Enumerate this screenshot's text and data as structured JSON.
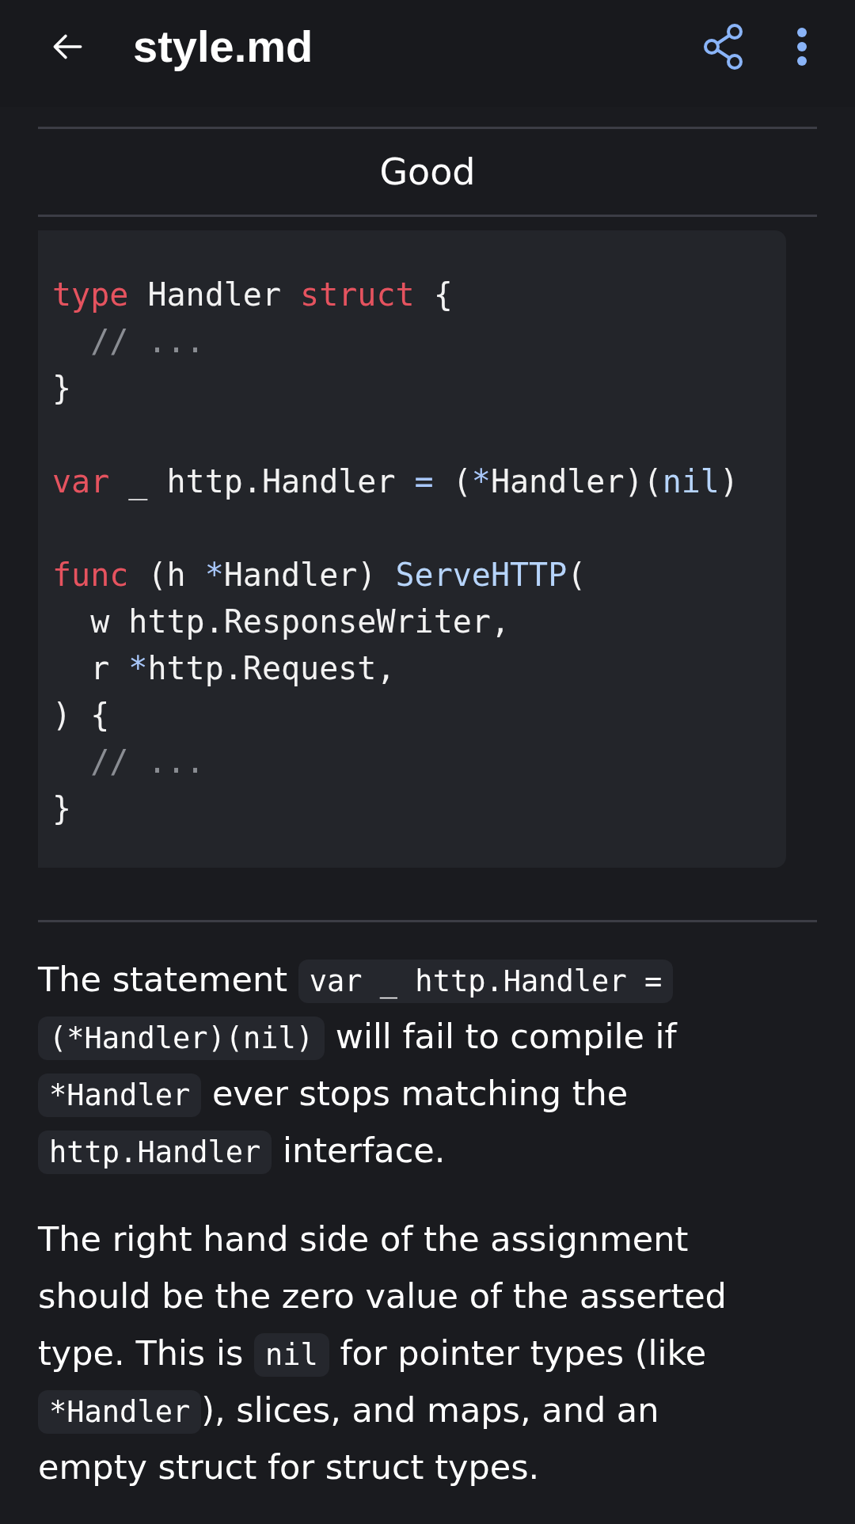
{
  "app_bar": {
    "title": "style.md"
  },
  "table_header": "Good",
  "code_block": {
    "lines": [
      {
        "kind": "code",
        "tokens": [
          {
            "text": "type",
            "kind": "keyword"
          },
          {
            "text": " Handler ",
            "kind": "plain"
          },
          {
            "text": "struct",
            "kind": "keyword"
          },
          {
            "text": " {",
            "kind": "plain"
          }
        ]
      },
      {
        "kind": "code",
        "tokens": [
          {
            "text": "  // ...",
            "kind": "comment"
          }
        ]
      },
      {
        "kind": "code",
        "tokens": [
          {
            "text": "}",
            "kind": "plain"
          }
        ]
      },
      {
        "kind": "blank"
      },
      {
        "kind": "code",
        "tokens": [
          {
            "text": "var",
            "kind": "keyword"
          },
          {
            "text": " _ http.Handler ",
            "kind": "plain"
          },
          {
            "text": "=",
            "kind": "operator"
          },
          {
            "text": " (",
            "kind": "plain"
          },
          {
            "text": "*",
            "kind": "operator"
          },
          {
            "text": "Handler)(",
            "kind": "plain"
          },
          {
            "text": "nil",
            "kind": "literal"
          },
          {
            "text": ")",
            "kind": "plain"
          }
        ]
      },
      {
        "kind": "blank"
      },
      {
        "kind": "code",
        "tokens": [
          {
            "text": "func",
            "kind": "keyword"
          },
          {
            "text": " (h ",
            "kind": "plain"
          },
          {
            "text": "*",
            "kind": "operator"
          },
          {
            "text": "Handler) ",
            "kind": "plain"
          },
          {
            "text": "ServeHTTP",
            "kind": "function"
          },
          {
            "text": "(",
            "kind": "plain"
          }
        ]
      },
      {
        "kind": "code",
        "tokens": [
          {
            "text": "  w http.ResponseWriter,",
            "kind": "plain"
          }
        ]
      },
      {
        "kind": "code",
        "tokens": [
          {
            "text": "  r ",
            "kind": "plain"
          },
          {
            "text": "*",
            "kind": "operator"
          },
          {
            "text": "http.Request,",
            "kind": "plain"
          }
        ]
      },
      {
        "kind": "code",
        "tokens": [
          {
            "text": ") {",
            "kind": "plain"
          }
        ]
      },
      {
        "kind": "code",
        "tokens": [
          {
            "text": "  // ...",
            "kind": "comment"
          }
        ]
      },
      {
        "kind": "code",
        "tokens": [
          {
            "text": "}",
            "kind": "plain"
          }
        ]
      }
    ]
  },
  "paragraphs": [
    {
      "lines": [
        [
          {
            "text": "The statement ",
            "kind": "text"
          },
          {
            "text": "var _ http.Handler =",
            "kind": "code"
          }
        ],
        [
          {
            "text": "(*Handler)(nil)",
            "kind": "code"
          },
          {
            "text": " will fail to compile if",
            "kind": "text"
          }
        ],
        [
          {
            "text": "*Handler",
            "kind": "code"
          },
          {
            "text": " ever stops matching the",
            "kind": "text"
          }
        ],
        [
          {
            "text": "http.Handler",
            "kind": "code"
          },
          {
            "text": " interface.",
            "kind": "text"
          }
        ]
      ]
    },
    {
      "lines": [
        [
          {
            "text": "The right hand side of the assignment",
            "kind": "text"
          }
        ],
        [
          {
            "text": "should be the zero value of the asserted",
            "kind": "text"
          }
        ],
        [
          {
            "text": "type. This is ",
            "kind": "text"
          },
          {
            "text": "nil",
            "kind": "code"
          },
          {
            "text": " for pointer types (like",
            "kind": "text"
          }
        ],
        [
          {
            "text": "*Handler",
            "kind": "code"
          },
          {
            "text": "), slices, and maps, and an",
            "kind": "text"
          }
        ],
        [
          {
            "text": "empty struct for struct types.",
            "kind": "text"
          }
        ]
      ]
    }
  ]
}
